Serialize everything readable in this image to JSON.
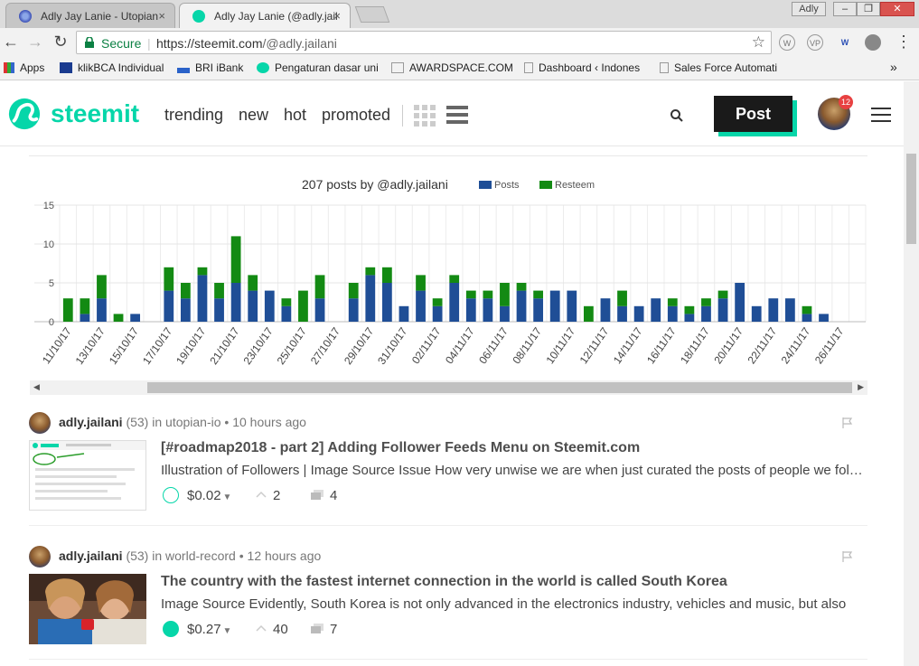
{
  "browser": {
    "tabs": [
      {
        "title": "Adly Jay Lanie - Utopian",
        "close": "×"
      },
      {
        "title": "Adly Jay Lanie (@adly.jail",
        "close": "×"
      }
    ],
    "window_user": "Adly",
    "window_buttons": [
      "–",
      "❐",
      "✕"
    ],
    "secure_label": "Secure",
    "url_main": "https://steemit.com",
    "url_path": "/@adly.jailani",
    "bookmarks": [
      "Apps",
      "klikBCA Individual",
      "BRI iBank",
      "Pengaturan dasar uni",
      "AWARDSPACE.COM",
      "Dashboard ‹ Indones",
      "Sales Force Automati"
    ],
    "bookmarks_more": "»",
    "extensions": [
      "W",
      "VP",
      "W"
    ]
  },
  "header": {
    "logo_text": "steemit",
    "nav": [
      "trending",
      "new",
      "hot",
      "promoted"
    ],
    "post_button": "Post",
    "notification_count": "12",
    "colors": {
      "brand": "#06d6a9",
      "dark": "#1a1a1a"
    }
  },
  "chart_data": {
    "type": "bar",
    "stacked": true,
    "title": "207 posts by @adly.jailani",
    "legend_position": "top",
    "x": [
      "11/10/17",
      "12/10/17",
      "13/10/17",
      "14/10/17",
      "15/10/17",
      "16/10/17",
      "17/10/17",
      "18/10/17",
      "19/10/17",
      "20/10/17",
      "21/10/17",
      "22/10/17",
      "23/10/17",
      "24/10/17",
      "25/10/17",
      "26/10/17",
      "27/10/17",
      "28/10/17",
      "29/10/17",
      "30/10/17",
      "31/10/17",
      "01/11/17",
      "02/11/17",
      "03/11/17",
      "04/11/17",
      "05/11/17",
      "06/11/17",
      "07/11/17",
      "08/11/17",
      "09/11/17",
      "10/11/17",
      "11/11/17",
      "12/11/17",
      "13/11/17",
      "14/11/17",
      "15/11/17",
      "16/11/17",
      "17/11/17",
      "18/11/17",
      "19/11/17",
      "20/11/17",
      "21/11/17",
      "22/11/17",
      "23/11/17",
      "24/11/17",
      "25/11/17",
      "26/11/17",
      "27/11/17"
    ],
    "tick_labels": [
      "11/10/17",
      "13/10/17",
      "15/10/17",
      "17/10/17",
      "19/10/17",
      "21/10/17",
      "23/10/17",
      "25/10/17",
      "27/10/17",
      "29/10/17",
      "31/10/17",
      "02/11/17",
      "04/11/17",
      "06/11/17",
      "08/11/17",
      "10/11/17",
      "12/11/17",
      "14/11/17",
      "16/11/17",
      "18/11/17",
      "20/11/17",
      "22/11/17",
      "24/11/17",
      "26/11/17"
    ],
    "series": [
      {
        "name": "Posts",
        "color": "#1f4e96",
        "values": [
          0,
          1,
          3,
          0,
          1,
          0,
          4,
          3,
          6,
          3,
          5,
          4,
          4,
          2,
          0,
          3,
          0,
          3,
          6,
          5,
          2,
          4,
          2,
          5,
          3,
          3,
          2,
          4,
          3,
          4,
          4,
          0,
          3,
          2,
          2,
          3,
          2,
          1,
          2,
          3,
          5,
          2,
          3,
          3,
          1,
          1,
          0,
          0
        ]
      },
      {
        "name": "Resteem",
        "color": "#138a13",
        "values": [
          3,
          2,
          3,
          1,
          0,
          0,
          3,
          2,
          1,
          2,
          6,
          2,
          0,
          1,
          4,
          3,
          0,
          2,
          1,
          2,
          0,
          2,
          1,
          1,
          1,
          1,
          3,
          1,
          1,
          0,
          0,
          2,
          0,
          2,
          0,
          0,
          1,
          1,
          1,
          1,
          0,
          0,
          0,
          0,
          1,
          0,
          0,
          0
        ]
      }
    ],
    "ylim": [
      0,
      15
    ],
    "yticks": [
      0,
      5,
      10,
      15
    ],
    "grid": true
  },
  "posts": [
    {
      "author": "adly.jailani",
      "reputation": "(53)",
      "in_label": "in",
      "category": "utopian-io",
      "time": "10 hours ago",
      "title": "[#roadmap2018 - part 2] Adding Follower Feeds Menu on Steemit.com",
      "body": "Illustration of Followers | Image Source Issue How very unwise we are when just curated the posts of people we follow",
      "payout": "$0.02",
      "reblogs": "2",
      "comments": "4",
      "voted": false
    },
    {
      "author": "adly.jailani",
      "reputation": "(53)",
      "in_label": "in",
      "category": "world-record",
      "time": "12 hours ago",
      "title": "The country with the fastest internet connection in the world is called South Korea",
      "body": "Image Source Evidently, South Korea is not only advanced in the electronics industry, vehicles and music, but also",
      "payout": "$0.27",
      "reblogs": "40",
      "comments": "7",
      "voted": true
    }
  ]
}
